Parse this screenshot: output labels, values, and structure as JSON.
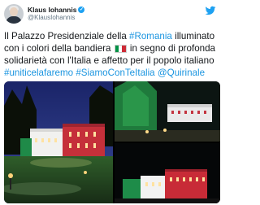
{
  "tweet": {
    "display_name": "Klaus Iohannis",
    "handle": "@KlausIohannis",
    "text_parts": [
      {
        "type": "text",
        "value": "Il Palazzo Presidenziale della "
      },
      {
        "type": "tag",
        "value": "#Romania"
      },
      {
        "type": "text",
        "value": " illuminato con i colori della bandiera "
      },
      {
        "type": "flag",
        "value": "italian-flag-emoji"
      },
      {
        "type": "text",
        "value": " in segno di profonda solidarietà con l'Italia e affetto per il popolo italiano "
      },
      {
        "type": "tag",
        "value": "#uniticelafaremo"
      },
      {
        "type": "text",
        "value": " "
      },
      {
        "type": "tag",
        "value": "#SiamoConTeItalia"
      },
      {
        "type": "text",
        "value": " "
      },
      {
        "type": "tag",
        "value": "@Quirinale"
      }
    ]
  },
  "colors": {
    "link": "#1b95e0",
    "verified": "#1da1f2",
    "flag_green": "#009246",
    "flag_white": "#ffffff",
    "flag_red": "#ce2b37"
  },
  "icons": {
    "verified": "verified-badge-icon",
    "follow": "follow-bird-icon",
    "flag": "italian-flag-emoji"
  }
}
